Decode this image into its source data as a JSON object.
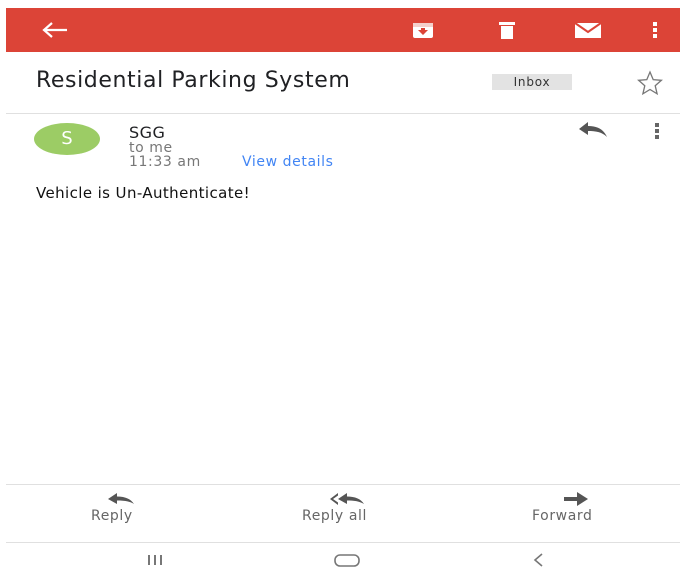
{
  "appbar": {
    "background": "#dc4437",
    "icons": [
      "back-arrow-icon",
      "archive-icon",
      "delete-icon",
      "mark-unread-icon",
      "more-vert-icon"
    ]
  },
  "email": {
    "subject": "Residential Parking System",
    "label": "Inbox",
    "sender": {
      "avatar_letter": "S",
      "avatar_color": "#9ccc65",
      "name": "SGG",
      "recipient": "to me",
      "time": "11:33 am",
      "view_details": "View details"
    },
    "body": "Vehicle is Un-Authenticate!"
  },
  "actions": {
    "reply": "Reply",
    "reply_all": "Reply all",
    "forward": "Forward"
  },
  "navbar": {
    "icons": [
      "recent-apps-icon",
      "home-icon",
      "back-icon"
    ]
  },
  "colors": {
    "accent_red": "#dc4437",
    "link_blue": "#4285f4"
  }
}
